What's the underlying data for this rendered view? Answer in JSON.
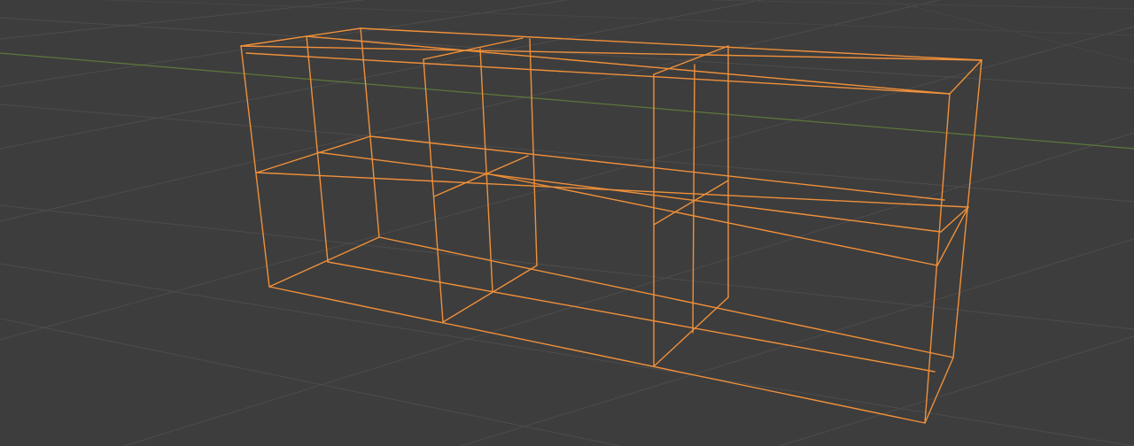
{
  "viewport": {
    "background_color": "#3d3d3d",
    "grid_color": "#4c4c4c",
    "x_axis_color": "#5c7a3a",
    "selection_color": "#f0903a",
    "shading_mode": "wireframe",
    "selected_object": {
      "type": "shelf-mesh",
      "selected": true
    }
  }
}
